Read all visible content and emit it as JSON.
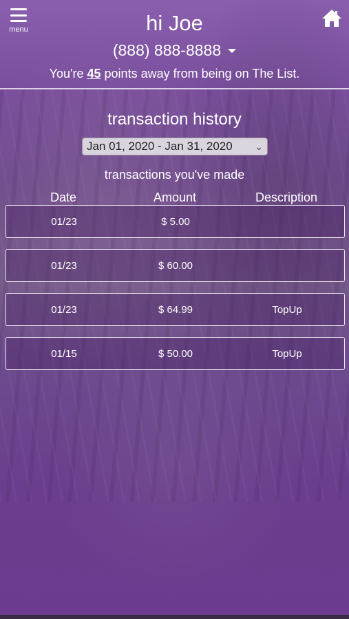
{
  "header": {
    "menu_label": "menu",
    "greeting": "hi Joe",
    "phone": "(888) 888-8888",
    "points_prefix": "You're",
    "points_value": "45",
    "points_suffix": "points away from being on The List."
  },
  "history": {
    "title": "transaction history",
    "date_range": "Jan 01, 2020 - Jan 31, 2020",
    "subtitle": "transactions you've made",
    "columns": [
      "Date",
      "Amount",
      "Description"
    ],
    "rows": [
      {
        "date": "01/23",
        "amount": "$ 5.00",
        "description": ""
      },
      {
        "date": "01/23",
        "amount": "$ 60.00",
        "description": ""
      },
      {
        "date": "01/23",
        "amount": "$ 64.99",
        "description": "TopUp"
      },
      {
        "date": "01/15",
        "amount": "$ 50.00",
        "description": "TopUp"
      }
    ]
  },
  "icons": {
    "menu": "hamburger-menu-icon",
    "home": "home-icon",
    "phone_dropdown": "caret-down-icon",
    "date_dropdown": "chevron-down-icon"
  }
}
